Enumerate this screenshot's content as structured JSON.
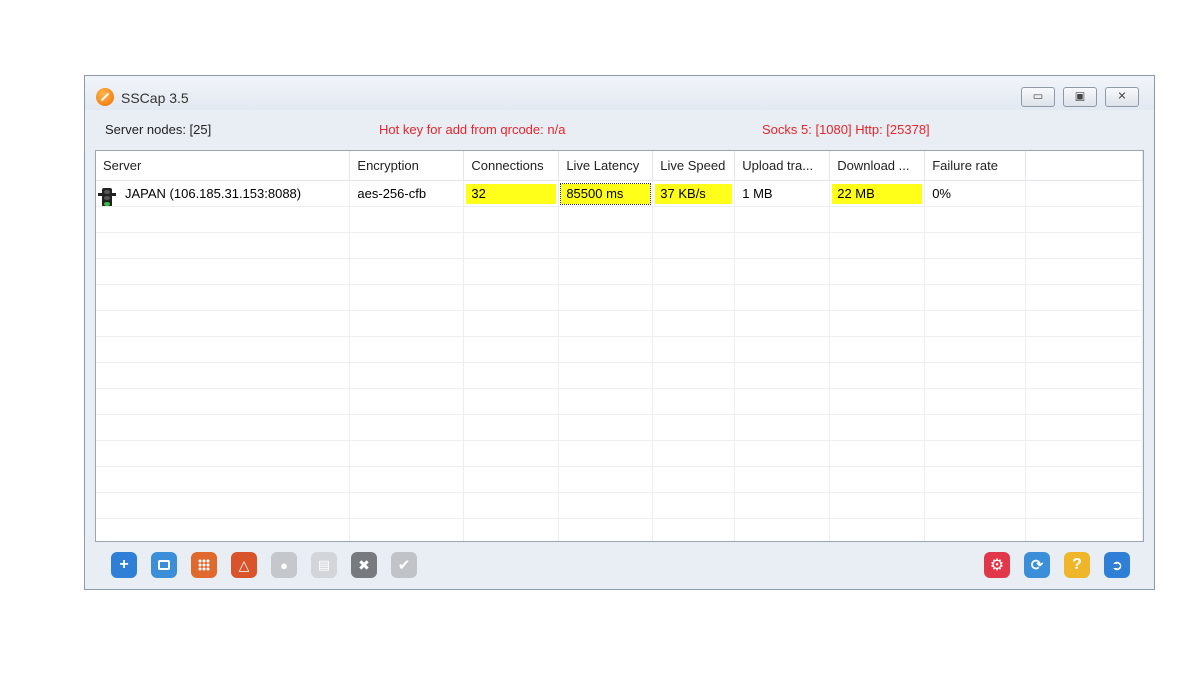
{
  "window": {
    "title": "SSCap 3.5"
  },
  "info": {
    "server_nodes": "Server nodes: [25]",
    "hotkey": "Hot key for add from qrcode: n/a",
    "ports": "Socks 5: [1080] Http: [25378]"
  },
  "table": {
    "columns": [
      "Server",
      "Encryption",
      "Connections",
      "Live Latency",
      "Live Speed",
      "Upload tra...",
      "Download ...",
      "Failure rate"
    ],
    "rows": [
      {
        "server": "JAPAN (106.185.31.153:8088)",
        "encryption": "aes-256-cfb",
        "connections": "32",
        "latency": "85500 ms",
        "speed": "37 KB/s",
        "upload": "1 MB",
        "download": "22 MB",
        "failure": "0%"
      }
    ]
  },
  "toolbar": {
    "left": [
      {
        "icon": "add-icon",
        "color": "#2f7fd6"
      },
      {
        "icon": "qrcode-icon",
        "color": "#3b8fd9"
      },
      {
        "icon": "grid-icon",
        "color": "#e0692e"
      },
      {
        "icon": "share-icon",
        "color": "#d9532b"
      },
      {
        "icon": "lightbulb-icon",
        "color": "#c4c7cc"
      },
      {
        "icon": "document-icon",
        "color": "#d2d5d9"
      },
      {
        "icon": "close-icon",
        "color": "#777b80"
      },
      {
        "icon": "check-icon",
        "color": "#c0c4c8"
      }
    ],
    "right": [
      {
        "icon": "settings-icon",
        "color": "#e0384a"
      },
      {
        "icon": "refresh-icon",
        "color": "#3b8fd9"
      },
      {
        "icon": "help-icon",
        "color": "#f0b62a"
      },
      {
        "icon": "exit-icon",
        "color": "#2f7fd6"
      }
    ]
  },
  "colors": {
    "highlight": "#ffff1a",
    "alert_text": "#e5252a"
  }
}
